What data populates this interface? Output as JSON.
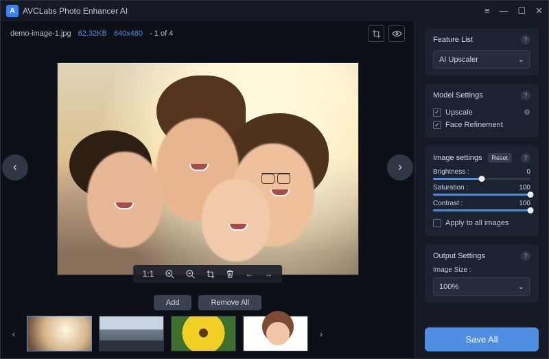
{
  "titlebar": {
    "app_name": "AVCLabs Photo Enhancer AI"
  },
  "fileinfo": {
    "name": "demo-image-1.jpg",
    "size": "62.32KB",
    "dims": "640x480",
    "counter": "- 1 of 4"
  },
  "toolbar": {
    "ratio": "1:1"
  },
  "actions": {
    "add": "Add",
    "remove_all": "Remove All"
  },
  "sidebar": {
    "feature_list": {
      "title": "Feature List",
      "selected": "AI Upscaler"
    },
    "model": {
      "title": "Model Settings",
      "upscale": {
        "label": "Upscale",
        "checked": true
      },
      "face": {
        "label": "Face Refinement",
        "checked": true
      }
    },
    "image": {
      "title": "Image settings",
      "reset": "Reset",
      "brightness": {
        "label": "Brightness :",
        "value": "0",
        "pct": 50
      },
      "saturation": {
        "label": "Saturation :",
        "value": "100",
        "pct": 100
      },
      "contrast": {
        "label": "Contrast :",
        "value": "100",
        "pct": 100
      },
      "apply_all": {
        "label": "Apply to all images",
        "checked": false
      }
    },
    "output": {
      "title": "Output Settings",
      "size_label": "Image Size :",
      "size_value": "100%"
    },
    "save_all": "Save All"
  }
}
